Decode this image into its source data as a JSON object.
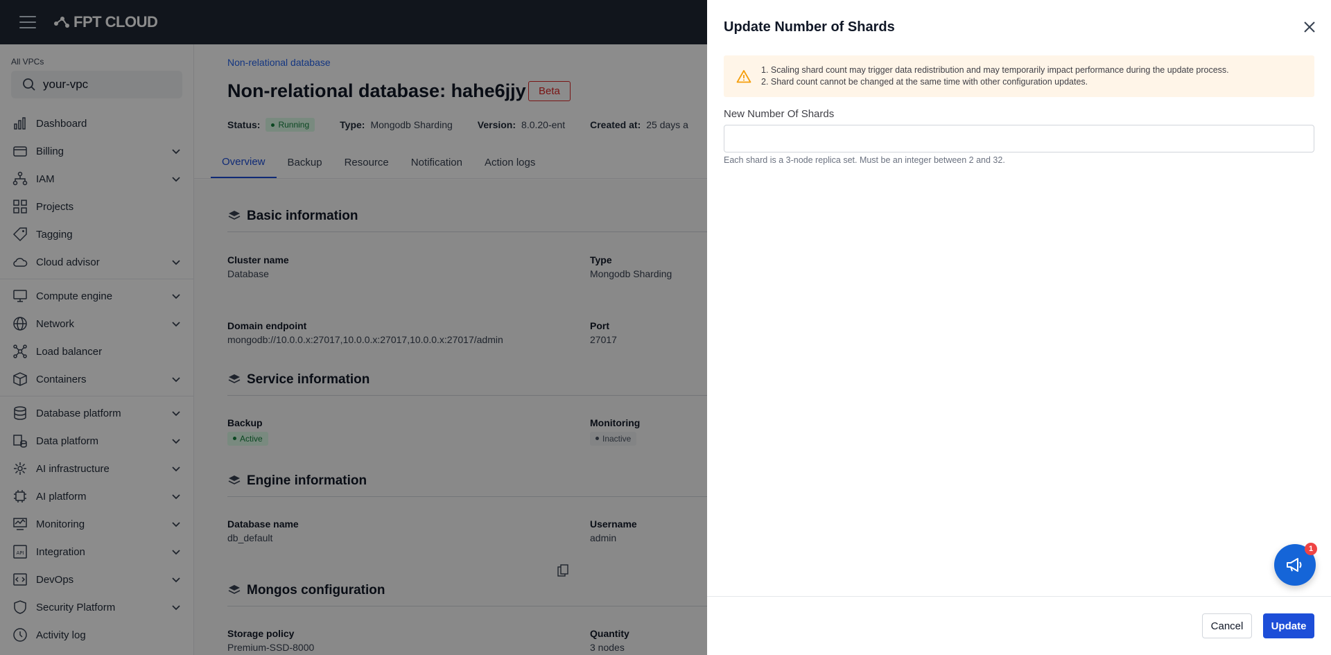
{
  "brand": {
    "logo_text": "FPT CLOUD"
  },
  "sidebar": {
    "vpc_label": "All VPCs",
    "vpc_value": "your-vpc",
    "items": [
      {
        "label": "Dashboard",
        "icon": "chart-icon",
        "chevron": false
      },
      {
        "label": "Billing",
        "icon": "wallet-icon",
        "chevron": true
      },
      {
        "label": "IAM",
        "icon": "org-icon",
        "chevron": true
      },
      {
        "label": "Projects",
        "icon": "grid-icon",
        "chevron": false
      },
      {
        "label": "Tagging",
        "icon": "tag-icon",
        "chevron": false
      },
      {
        "label": "Cloud advisor",
        "icon": "cloud-icon",
        "chevron": true
      },
      {
        "label": "Compute engine",
        "icon": "monitor-icon",
        "chevron": true
      },
      {
        "label": "Network",
        "icon": "globe-icon",
        "chevron": true
      },
      {
        "label": "Load balancer",
        "icon": "network-icon",
        "chevron": false
      },
      {
        "label": "Containers",
        "icon": "box-icon",
        "chevron": true
      },
      {
        "label": "Database platform",
        "icon": "database-icon",
        "chevron": true
      },
      {
        "label": "Data platform",
        "icon": "data-icon",
        "chevron": true
      },
      {
        "label": "AI infrastructure",
        "icon": "ai-infra-icon",
        "chevron": true
      },
      {
        "label": "AI platform",
        "icon": "ai-chip-icon",
        "chevron": true
      },
      {
        "label": "Monitoring",
        "icon": "monitoring-icon",
        "chevron": true
      },
      {
        "label": "Integration",
        "icon": "api-icon",
        "chevron": true
      },
      {
        "label": "DevOps",
        "icon": "code-icon",
        "chevron": true
      },
      {
        "label": "Security Platform",
        "icon": "shield-icon",
        "chevron": true
      },
      {
        "label": "Activity log",
        "icon": "clock-icon",
        "chevron": false
      }
    ]
  },
  "main": {
    "breadcrumb": "Non-relational database",
    "title": "Non-relational database: hahe6jjy",
    "beta": "Beta",
    "status": {
      "status_label": "Status:",
      "status_value": "Running",
      "type_label": "Type:",
      "type_value": "Mongodb Sharding",
      "version_label": "Version:",
      "version_value": "8.0.20-ent",
      "created_label": "Created at:",
      "created_value": "25 days a"
    },
    "tabs": [
      "Overview",
      "Backup",
      "Resource",
      "Notification",
      "Action logs"
    ],
    "sections": {
      "basic": "Basic information",
      "service": "Service information",
      "engine": "Engine information",
      "mongos": "Mongos configuration"
    },
    "fields": {
      "cluster_name_k": "Cluster name",
      "cluster_name_v": "Database",
      "type_k": "Type",
      "type_v": "Mongodb Sharding",
      "domain_k": "Domain endpoint",
      "domain_v": "mongodb://10.0.0.x:27017,10.0.0.x:27017,10.0.0.x:27017/admin",
      "port_k": "Port",
      "port_v": "27017",
      "backup_k": "Backup",
      "backup_v": "Active",
      "monitoring_k": "Monitoring",
      "monitoring_v": "Inactive",
      "dbname_k": "Database name",
      "dbname_v": "db_default",
      "username_k": "Username",
      "username_v": "admin",
      "storage_k": "Storage policy",
      "storage_v": "Premium-SSD-8000",
      "quantity_k": "Quantity",
      "quantity_v": "3 nodes"
    }
  },
  "drawer": {
    "title": "Update Number of Shards",
    "warning_1": "1. Scaling shard count may trigger data redistribution and may temporarily impact performance during the update process.",
    "warning_2": "2. Shard count cannot be changed at the same time with other configuration updates.",
    "field_label": "New Number Of Shards",
    "field_value": "",
    "hint": "Each shard is a 3-node replica set. Must be an integer between 2 and 32.",
    "cancel": "Cancel",
    "update": "Update",
    "notification_count": "1"
  },
  "colors": {
    "accent": "#1d4ed8",
    "topbar": "#1f2733",
    "warning_bg": "#fff5e8",
    "danger": "#dc2626"
  }
}
